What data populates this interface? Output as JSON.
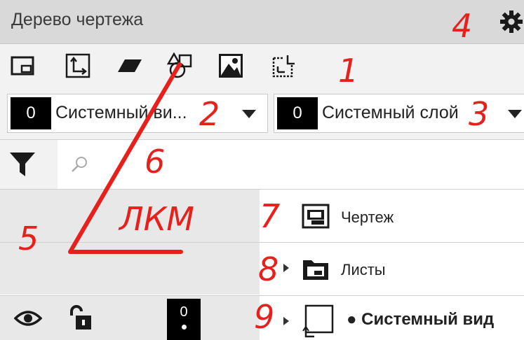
{
  "panel": {
    "title": "Дерево чертежа"
  },
  "toolbar": {
    "buttons": [
      {
        "icon": "view-frame-icon"
      },
      {
        "icon": "local-cs-icon"
      },
      {
        "icon": "parallelogram-icon"
      },
      {
        "icon": "shapes-icon"
      },
      {
        "icon": "image-icon"
      },
      {
        "icon": "coordinate-transform-icon"
      }
    ]
  },
  "dropdowns": {
    "view": {
      "number": "0",
      "text": "Системный ви..."
    },
    "layer": {
      "number": "0",
      "text": "Системный слой"
    }
  },
  "tree": {
    "items": [
      {
        "label": "Чертеж",
        "icon": "drawing-doc-icon"
      },
      {
        "label": "Листы",
        "icon": "sheets-folder-icon"
      },
      {
        "label": "● Системный вид",
        "icon": "view-icon",
        "layer_number": "0"
      }
    ]
  },
  "annotations": {
    "n1": "1",
    "n2": "2",
    "n3": "3",
    "n4": "4",
    "n5": "5",
    "n6": "6",
    "n7": "7",
    "n8": "8",
    "n9": "9",
    "lkm": "ЛКМ",
    "color": "#e8201c"
  }
}
